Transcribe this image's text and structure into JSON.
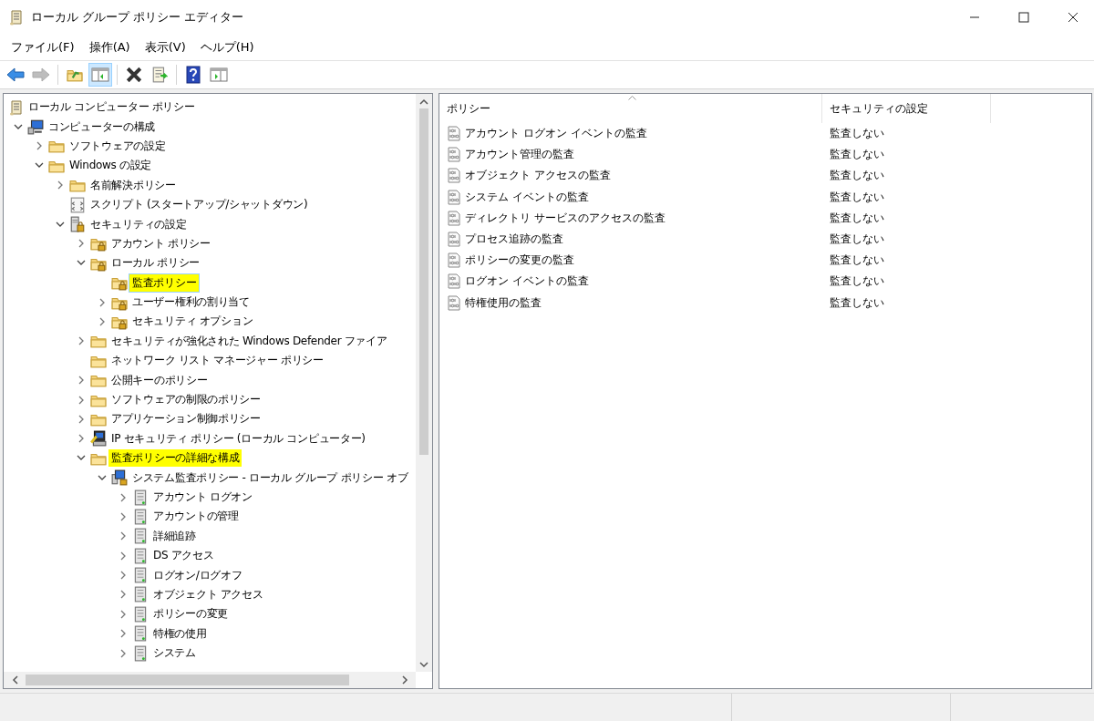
{
  "window": {
    "title": "ローカル グループ ポリシー エディター"
  },
  "menu": [
    "ファイル(F)",
    "操作(A)",
    "表示(V)",
    "ヘルプ(H)"
  ],
  "toolbar": [
    {
      "kind": "back",
      "disabled": false,
      "pressed": false
    },
    {
      "kind": "forward",
      "disabled": true,
      "pressed": false
    },
    {
      "kind": "up",
      "disabled": false,
      "pressed": false
    },
    {
      "kind": "tree-pane",
      "disabled": false,
      "pressed": true
    },
    {
      "kind": "delete",
      "disabled": false,
      "pressed": false
    },
    {
      "kind": "export",
      "disabled": false,
      "pressed": false
    },
    {
      "kind": "help",
      "disabled": false,
      "pressed": false
    },
    {
      "kind": "action-pane",
      "disabled": false,
      "pressed": false
    }
  ],
  "tree": [
    {
      "label": "ローカル コンピューター ポリシー",
      "kind": "scroll",
      "selected": false,
      "highlighted": false,
      "children": [
        {
          "label": "コンピューターの構成",
          "kind": "computer",
          "expanded": true,
          "selected": false,
          "highlighted": false,
          "children": [
            {
              "label": "ソフトウェアの設定",
              "kind": "folder",
              "expanded": false,
              "selected": false,
              "highlighted": false
            },
            {
              "label": "Windows の設定",
              "kind": "folder",
              "expanded": true,
              "selected": false,
              "highlighted": false,
              "children": [
                {
                  "label": "名前解決ポリシー",
                  "kind": "folder",
                  "expanded": false,
                  "selected": false,
                  "highlighted": false
                },
                {
                  "label": "スクリプト (スタートアップ/シャットダウン)",
                  "kind": "script",
                  "selected": false,
                  "highlighted": false
                },
                {
                  "label": "セキュリティの設定",
                  "kind": "security",
                  "expanded": true,
                  "selected": false,
                  "highlighted": false,
                  "children": [
                    {
                      "label": "アカウント ポリシー",
                      "kind": "lock-folder",
                      "expanded": false,
                      "selected": false,
                      "highlighted": false
                    },
                    {
                      "label": "ローカル ポリシー",
                      "kind": "lock-folder",
                      "expanded": true,
                      "selected": false,
                      "highlighted": false,
                      "children": [
                        {
                          "label": "監査ポリシー",
                          "kind": "lock-folder",
                          "selected": true,
                          "highlighted": true
                        },
                        {
                          "label": "ユーザー権利の割り当て",
                          "kind": "lock-folder",
                          "expanded": false,
                          "selected": false,
                          "highlighted": false
                        },
                        {
                          "label": "セキュリティ オプション",
                          "kind": "lock-folder",
                          "expanded": false,
                          "selected": false,
                          "highlighted": false
                        }
                      ]
                    },
                    {
                      "label": "セキュリティが強化された Windows Defender ファイア",
                      "kind": "folder",
                      "expanded": false,
                      "selected": false,
                      "highlighted": false
                    },
                    {
                      "label": "ネットワーク リスト マネージャー ポリシー",
                      "kind": "folder",
                      "selected": false,
                      "highlighted": false
                    },
                    {
                      "label": "公開キーのポリシー",
                      "kind": "folder",
                      "expanded": false,
                      "selected": false,
                      "highlighted": false
                    },
                    {
                      "label": "ソフトウェアの制限のポリシー",
                      "kind": "folder",
                      "expanded": false,
                      "selected": false,
                      "highlighted": false
                    },
                    {
                      "label": "アプリケーション制御ポリシー",
                      "kind": "folder",
                      "expanded": false,
                      "selected": false,
                      "highlighted": false
                    },
                    {
                      "label": "IP セキュリティ ポリシー (ローカル コンピューター)",
                      "kind": "ip",
                      "expanded": false,
                      "selected": false,
                      "highlighted": false
                    },
                    {
                      "label": "監査ポリシーの詳細な構成",
                      "kind": "folder",
                      "expanded": true,
                      "selected": false,
                      "highlighted": true,
                      "children": [
                        {
                          "label": "システム監査ポリシー - ローカル グループ ポリシー オブ",
                          "kind": "audit",
                          "expanded": true,
                          "selected": false,
                          "highlighted": false,
                          "children": [
                            {
                              "label": "アカウント ログオン",
                              "kind": "category",
                              "expanded": false,
                              "selected": false,
                              "highlighted": false
                            },
                            {
                              "label": "アカウントの管理",
                              "kind": "category",
                              "expanded": false,
                              "selected": false,
                              "highlighted": false
                            },
                            {
                              "label": "詳細追跡",
                              "kind": "category",
                              "expanded": false,
                              "selected": false,
                              "highlighted": false
                            },
                            {
                              "label": "DS アクセス",
                              "kind": "category",
                              "expanded": false,
                              "selected": false,
                              "highlighted": false
                            },
                            {
                              "label": "ログオン/ログオフ",
                              "kind": "category",
                              "expanded": false,
                              "selected": false,
                              "highlighted": false
                            },
                            {
                              "label": "オブジェクト アクセス",
                              "kind": "category",
                              "expanded": false,
                              "selected": false,
                              "highlighted": false
                            },
                            {
                              "label": "ポリシーの変更",
                              "kind": "category",
                              "expanded": false,
                              "selected": false,
                              "highlighted": false
                            },
                            {
                              "label": "特権の使用",
                              "kind": "category",
                              "expanded": false,
                              "selected": false,
                              "highlighted": false
                            },
                            {
                              "label": "システム",
                              "kind": "category",
                              "expanded": false,
                              "selected": false,
                              "highlighted": false
                            }
                          ]
                        }
                      ]
                    }
                  ]
                }
              ]
            }
          ]
        }
      ]
    }
  ],
  "list": {
    "columns": [
      "ポリシー",
      "セキュリティの設定"
    ],
    "rows": [
      {
        "policy": "アカウント ログオン イベントの監査",
        "setting": "監査しない"
      },
      {
        "policy": "アカウント管理の監査",
        "setting": "監査しない"
      },
      {
        "policy": "オブジェクト アクセスの監査",
        "setting": "監査しない"
      },
      {
        "policy": "システム イベントの監査",
        "setting": "監査しない"
      },
      {
        "policy": "ディレクトリ サービスのアクセスの監査",
        "setting": "監査しない"
      },
      {
        "policy": "プロセス追跡の監査",
        "setting": "監査しない"
      },
      {
        "policy": "ポリシーの変更の監査",
        "setting": "監査しない"
      },
      {
        "policy": "ログオン イベントの監査",
        "setting": "監査しない"
      },
      {
        "policy": "特権使用の監査",
        "setting": "監査しない"
      }
    ]
  }
}
